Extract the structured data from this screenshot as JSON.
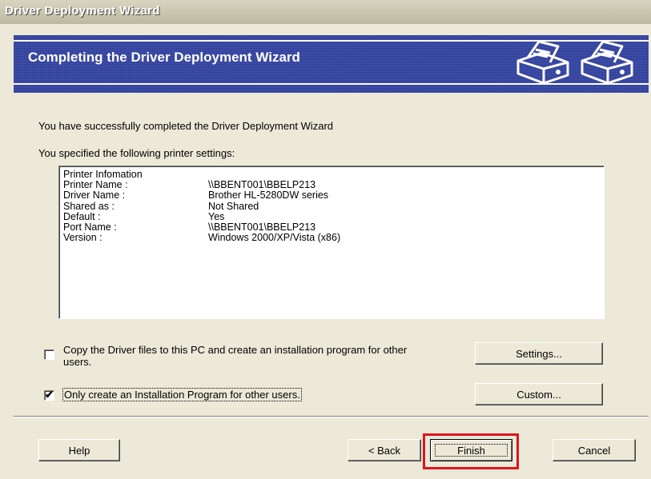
{
  "window": {
    "title": "Driver Deployment Wizard"
  },
  "banner": {
    "heading": "Completing the Driver Deployment Wizard",
    "icons": [
      "printer-icon",
      "printer-icon"
    ]
  },
  "main": {
    "success_text": "You have successfully completed the Driver Deployment Wizard",
    "settings_intro": "You specified the following printer settings:"
  },
  "printer_info": {
    "header": "Printer Infomation",
    "rows": [
      {
        "key": "Printer Name :",
        "value": "\\\\BBENT001\\BBELP213"
      },
      {
        "key": "Driver Name :",
        "value": "Brother HL-5280DW series"
      },
      {
        "key": "Shared as :",
        "value": "Not Shared"
      },
      {
        "key": "Default :",
        "value": "Yes"
      },
      {
        "key": "Port Name :",
        "value": "\\\\BBENT001\\BBELP213"
      },
      {
        "key": "Version :",
        "value": "Windows 2000/XP/Vista (x86)"
      }
    ]
  },
  "options": {
    "copy_files": {
      "checked": false,
      "line1": "Copy the Driver files to this PC and create an installation program for other",
      "line2": "users."
    },
    "install_only": {
      "checked": true,
      "label": "Only create an Installation Program for other users."
    }
  },
  "buttons": {
    "settings": "Settings...",
    "custom": "Custom...",
    "help": "Help",
    "back": "< Back",
    "finish": "Finish",
    "cancel": "Cancel"
  },
  "colors": {
    "banner": "#2a3a9a",
    "highlight": "#e0141e",
    "dialog_bg": "#ece9d8"
  }
}
